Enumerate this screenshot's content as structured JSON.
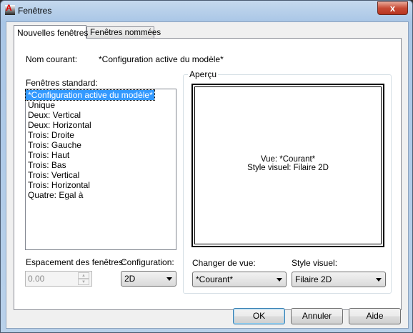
{
  "window": {
    "title": "Fenêtres",
    "close_label": "x"
  },
  "tabs": [
    {
      "label": "Nouvelles fenêtres",
      "active": true
    },
    {
      "label": "Fenêtres nommées",
      "active": false
    }
  ],
  "current_name": {
    "label": "Nom courant:",
    "value": "*Configuration active du modèle*"
  },
  "standard": {
    "label": "Fenêtres standard:",
    "items": [
      "*Configuration active du modèle*",
      "Unique",
      "Deux: Vertical",
      "Deux: Horizontal",
      "Trois: Droite",
      "Trois: Gauche",
      "Trois: Haut",
      "Trois: Bas",
      "Trois: Vertical",
      "Trois: Horizontal",
      "Quatre: Egal à"
    ],
    "selected": 0
  },
  "preview": {
    "label": "Aperçu",
    "line1": "Vue: *Courant*",
    "line2": "Style visuel: Filaire 2D"
  },
  "spacing": {
    "label": "Espacement des fenêtres:",
    "value": "0.00"
  },
  "configuration": {
    "label": "Configuration:",
    "value": "2D"
  },
  "change_view": {
    "label": "Changer de vue:",
    "value": "*Courant*"
  },
  "visual_style": {
    "label": "Style visuel:",
    "value": "Filaire 2D"
  },
  "buttons": {
    "ok": "OK",
    "cancel": "Annuler",
    "help": "Aide"
  }
}
